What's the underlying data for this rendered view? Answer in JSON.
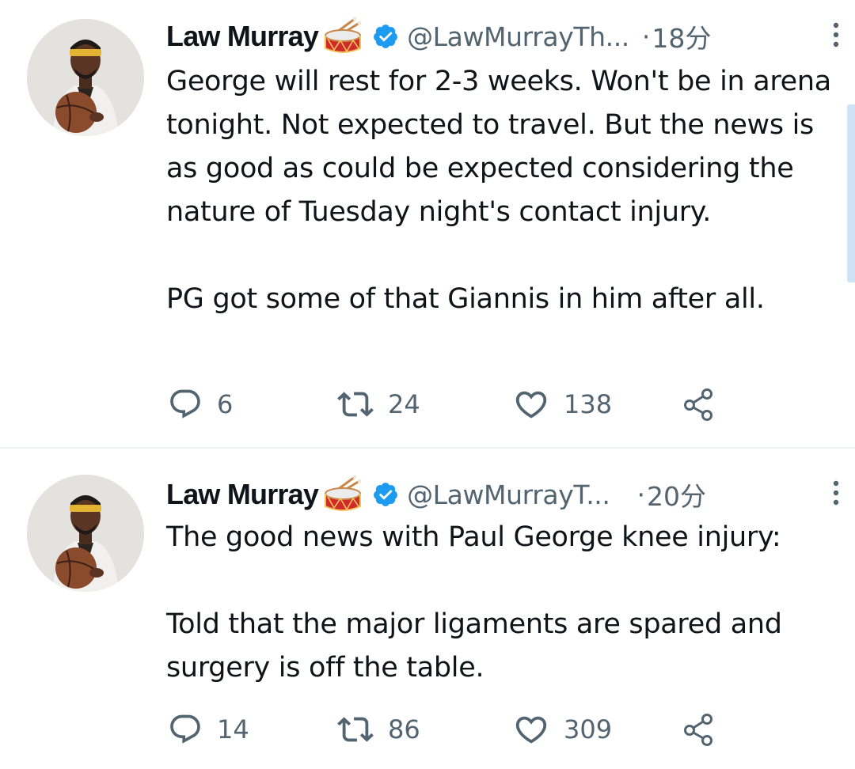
{
  "tweets": [
    {
      "author": {
        "display_name": "Law Murray",
        "emoji": "drum",
        "verified": true,
        "handle": "@LawMurrayTh...",
        "avatar": "avatar-man-with-basketball"
      },
      "separator": "·",
      "time": "18分",
      "body": [
        "George will rest for 2-3 weeks. Won't be in arena tonight. Not expected to travel. But the news is as good as could be expected considering the nature of Tuesday night's contact injury.",
        "PG got some of that Giannis in him after all."
      ],
      "stats": {
        "replies": "6",
        "retweets": "24",
        "likes": "138"
      }
    },
    {
      "author": {
        "display_name": "Law Murray",
        "emoji": "drum",
        "verified": true,
        "handle": "@LawMurrayT...",
        "avatar": "avatar-man-with-basketball"
      },
      "separator": "·",
      "time": "20分",
      "body": [
        "The good news with Paul George knee injury:",
        "Told that the major ligaments are spared and surgery is off the table."
      ],
      "stats": {
        "replies": "14",
        "retweets": "86",
        "likes": "309"
      }
    }
  ],
  "icons": {
    "reply": "reply-icon",
    "retweet": "retweet-icon",
    "like": "heart-icon",
    "share": "share-icon",
    "more": "more-vertical-icon",
    "verified": "verified-badge-icon"
  },
  "colors": {
    "text": "#0f1419",
    "secondary": "#536471",
    "verified": "#1d9bf0",
    "divider": "#eff3f4"
  }
}
